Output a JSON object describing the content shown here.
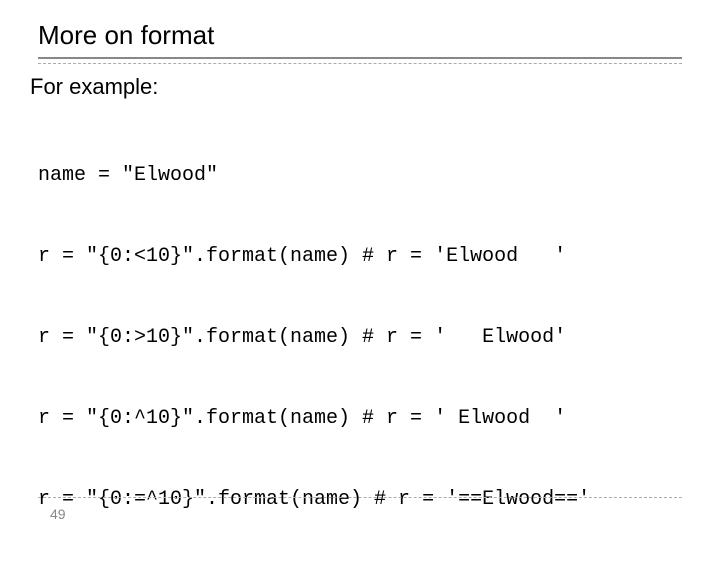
{
  "title": "More on format",
  "subtitle": "For example:",
  "code": {
    "l1": "name = \"Elwood\"",
    "l2": "r = \"{0:<10}\".format(name) # r = 'Elwood   '",
    "l3": "r = \"{0:>10}\".format(name) # r = '   Elwood'",
    "l4": "r = \"{0:^10}\".format(name) # r = ' Elwood  '",
    "l5": "r = \"{0:=^10}\".format(name) # r = '==Elwood=='"
  },
  "pagenum": "49"
}
